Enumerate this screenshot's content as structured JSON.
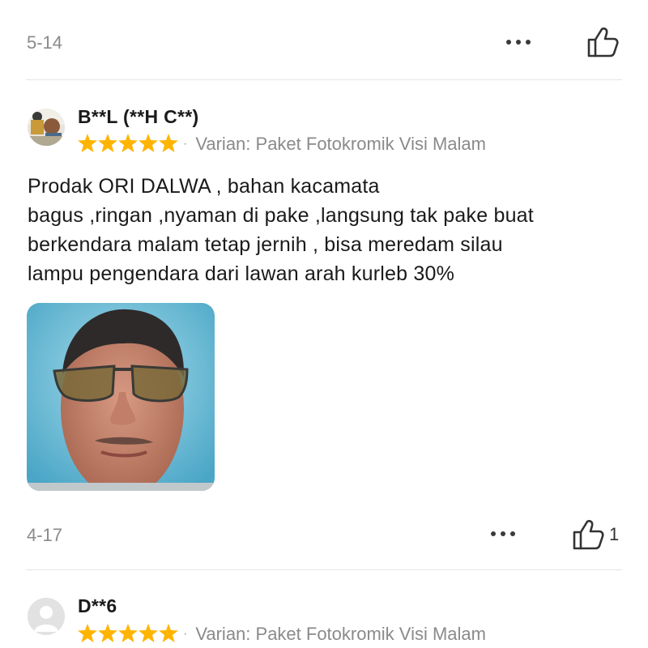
{
  "colors": {
    "star": "#ffb400",
    "muted": "#8a8a8a",
    "text": "#1a1a1a",
    "divider": "#e6e6e6"
  },
  "reviews": [
    {
      "date": "5-14",
      "like_count": ""
    },
    {
      "username": "B**L (**H C**)",
      "rating": 5,
      "variant": "Varian: Paket Fotokromik Visi Malam",
      "text_lines": [
        "Prodak ORI DALWA , bahan kacamata",
        "bagus ,ringan ,nyaman di pake ,langsung tak pake buat",
        "berkendara malam tetap jernih , bisa meredam silau",
        "lampu pengendara dari lawan arah kurleb 30%"
      ],
      "photo": "review-photo-man-wearing-yellow-night-vision-glasses",
      "date": "4-17",
      "like_count": "1"
    },
    {
      "username": "D**6",
      "rating": 5,
      "variant": "Varian: Paket Fotokromik Visi Malam",
      "avatar": "default-avatar-icon"
    }
  ],
  "icons": {
    "more": "more-dots-icon",
    "like": "thumbs-up-icon",
    "star": "star-icon"
  },
  "separator": "·"
}
